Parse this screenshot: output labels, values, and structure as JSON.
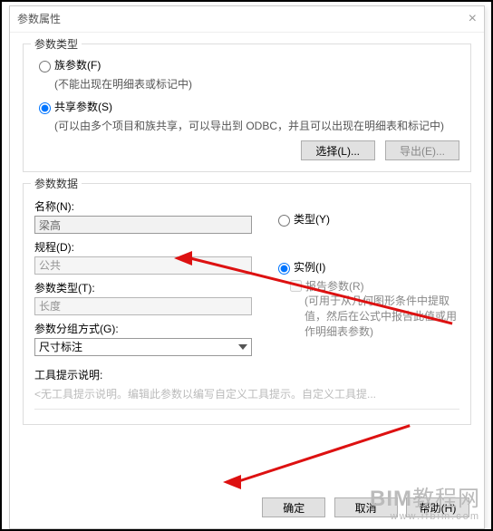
{
  "dialog": {
    "title": "参数属性"
  },
  "paramType": {
    "legend": "参数类型",
    "family": {
      "label": "族参数(F)",
      "hint": "(不能出现在明细表或标记中)"
    },
    "shared": {
      "label": "共享参数(S)",
      "hint": "(可以由多个项目和族共享，可以导出到 ODBC，并且可以出现在明细表和标记中)"
    },
    "selectBtn": "选择(L)...",
    "exportBtn": "导出(E)..."
  },
  "paramData": {
    "legend": "参数数据",
    "nameLabel": "名称(N):",
    "nameValue": "梁高",
    "disciplineLabel": "规程(D):",
    "disciplineValue": "公共",
    "typeLabel": "参数类型(T):",
    "typeValue": "长度",
    "groupLabel": "参数分组方式(G):",
    "groupValue": "尺寸标注",
    "typeRadio": "类型(Y)",
    "instanceRadio": "实例(I)",
    "reportChk": "报告参数(R)",
    "reportHint": "(可用于从几何图形条件中提取值，然后在公式中报告此值或用作明细表参数)",
    "toolLabel": "工具提示说明:",
    "toolHint": "<无工具提示说明。编辑此参数以编写自定义工具提示。自定义工具提..."
  },
  "footer": {
    "ok": "确定",
    "cancel": "取消",
    "help": "帮助(H)"
  },
  "watermark": {
    "brand": "BIM教程网",
    "url": "www.ifbim.com"
  }
}
